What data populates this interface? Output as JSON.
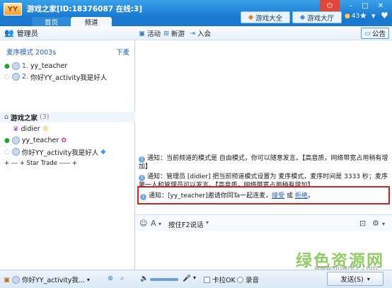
{
  "window": {
    "logo_text": "YY",
    "title": "游戏之家[ID:18376087 在线:3]",
    "min_glyph": "–",
    "max_glyph": "□",
    "close_glyph": "✕",
    "power_glyph": "⏻"
  },
  "tabs": [
    {
      "label": "首页"
    },
    {
      "label": "频道"
    }
  ],
  "header_links": {
    "games_all": "游戏大全",
    "games_hall": "游戏大厅",
    "coin_count": "43"
  },
  "admin": {
    "label": "管理员"
  },
  "queue": {
    "mode_label": "麦序模式 2003s",
    "list_link": "下麦",
    "items": [
      {
        "index": "1.",
        "name": "yy_teacher"
      },
      {
        "index": "2.",
        "name": "你好YY_activity我是好人"
      }
    ]
  },
  "room": {
    "name": "游戏之家",
    "count": "(3)",
    "members": [
      {
        "name": "didier"
      },
      {
        "name": "yy_teacher"
      },
      {
        "name": "你好YY_activity我是好人"
      }
    ],
    "sub_channel": "+ --- + Star Trade ----- +"
  },
  "chat_toolbar": {
    "activity": "活动",
    "new_game": "新游",
    "join": "入会",
    "notice": "公告"
  },
  "messages": {
    "m1": "通知：当前频道的模式是 自由模式，你可以随意发言。【高音质，网络带宽占用稍有增加】",
    "m2": "通知：管理员 [didier] 把当前频道模式设置为 麦序模式，麦序时间是 3333 秒；麦序第一人和管理员可以发言。【高音质，网络带宽占用稍有增加】",
    "m3_prefix": "通知：[yy_teacher]邀请你同Ta一起连麦，",
    "m3_accept": "接受",
    "m3_or": " 或 ",
    "m3_reject": "拒绝",
    "m3_suffix": "。"
  },
  "input_bar": {
    "ptt": "按住F2说话"
  },
  "bottom": {
    "user_name": "你好YY_activity我...",
    "karaoke": "卡拉OK",
    "record": "录音",
    "send": "发送(S)"
  },
  "watermark": {
    "main": "绿色资源网",
    "url": "www.downcc.com"
  },
  "colors": {
    "title_bar": "#1a79cf",
    "link": "#1f5fb0",
    "invite_border": "#d42020",
    "online_dot": "#22a030"
  }
}
